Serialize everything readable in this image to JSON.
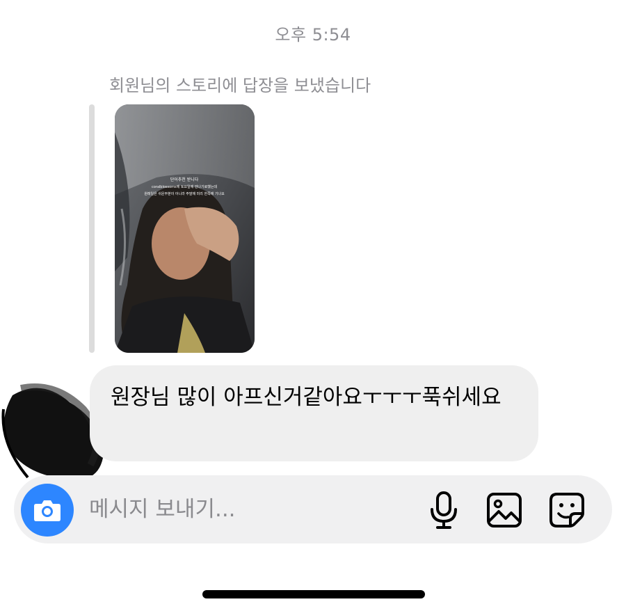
{
  "thread": {
    "timestamp": "오후 5:54",
    "reply_note": "회원님의 스토리에 답장을 보냈습니다",
    "message": "원장님 많이 아프신거같아요ㅜㅜㅜ푹쉬세요"
  },
  "story": {
    "caption_lines": [
      "단어추천 받니다",
      "coralblossoms에 토요일에 만나기로했는데",
      "원래일은 쉬운부분이 아니라 주말에 미리 한쪽에 기나요"
    ]
  },
  "composer": {
    "placeholder": "메시지 보내기...",
    "value": "",
    "icons": [
      "camera-icon",
      "microphone-icon",
      "gallery-icon",
      "sticker-icon"
    ]
  },
  "colors": {
    "accent": "#2d86ff",
    "bubble": "#efefef",
    "muted_text": "#8e8e93",
    "composer_bg": "#f0f0f1"
  }
}
